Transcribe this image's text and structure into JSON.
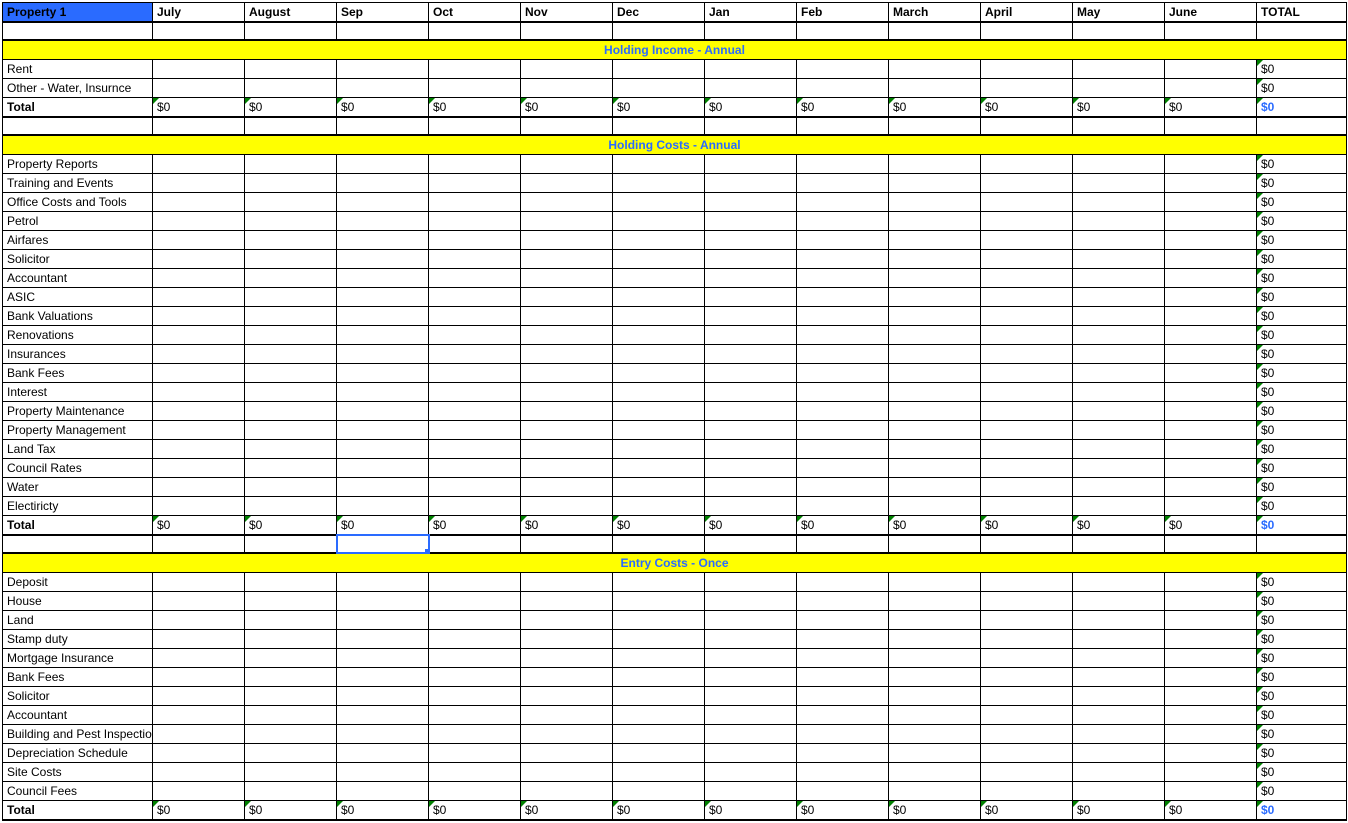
{
  "header": {
    "title": "Property 1",
    "months": [
      "July",
      "August",
      "Sep",
      "Oct",
      "Nov",
      "Dec",
      "Jan",
      "Feb",
      "March",
      "April",
      "May",
      "June"
    ],
    "total_label": "TOTAL"
  },
  "sections": [
    {
      "title": "Holding Income - Annual",
      "rows": [
        {
          "label": "Rent",
          "total": "$0"
        },
        {
          "label": "Other - Water, Insurnce",
          "total": "$0"
        }
      ],
      "total": {
        "label": "Total",
        "months": [
          "$0",
          "$0",
          "$0",
          "$0",
          "$0",
          "$0",
          "$0",
          "$0",
          "$0",
          "$0",
          "$0",
          "$0"
        ],
        "grand": "$0"
      }
    },
    {
      "title": "Holding Costs - Annual",
      "rows": [
        {
          "label": "Property Reports",
          "total": "$0"
        },
        {
          "label": "Training and Events",
          "total": "$0"
        },
        {
          "label": "Office Costs and Tools",
          "total": "$0"
        },
        {
          "label": "Petrol",
          "total": "$0"
        },
        {
          "label": "Airfares",
          "total": "$0"
        },
        {
          "label": "Solicitor",
          "total": "$0"
        },
        {
          "label": "Accountant",
          "total": "$0"
        },
        {
          "label": "ASIC",
          "total": "$0"
        },
        {
          "label": "Bank Valuations",
          "total": "$0"
        },
        {
          "label": "Renovations",
          "total": "$0"
        },
        {
          "label": "Insurances",
          "total": "$0"
        },
        {
          "label": "Bank Fees",
          "total": "$0"
        },
        {
          "label": "Interest",
          "total": "$0"
        },
        {
          "label": "Property Maintenance",
          "total": "$0"
        },
        {
          "label": "Property Management",
          "total": "$0"
        },
        {
          "label": "Land Tax",
          "total": "$0"
        },
        {
          "label": "Council Rates",
          "total": "$0"
        },
        {
          "label": "Water",
          "total": "$0"
        },
        {
          "label": "Electiricty",
          "total": "$0"
        }
      ],
      "total": {
        "label": "Total",
        "months": [
          "$0",
          "$0",
          "$0",
          "$0",
          "$0",
          "$0",
          "$0",
          "$0",
          "$0",
          "$0",
          "$0",
          "$0"
        ],
        "grand": "$0"
      }
    },
    {
      "title": "Entry Costs - Once",
      "rows": [
        {
          "label": "Deposit",
          "total": "$0"
        },
        {
          "label": "House",
          "total": "$0"
        },
        {
          "label": "Land",
          "total": "$0"
        },
        {
          "label": "Stamp duty",
          "total": "$0"
        },
        {
          "label": "Mortgage Insurance",
          "total": "$0"
        },
        {
          "label": "Bank Fees",
          "total": "$0"
        },
        {
          "label": "Solicitor",
          "total": "$0"
        },
        {
          "label": "Accountant",
          "total": "$0"
        },
        {
          "label": "Building and Pest Inspection",
          "total": "$0"
        },
        {
          "label": "Depreciation Schedule",
          "total": "$0"
        },
        {
          "label": "Site Costs",
          "total": "$0"
        },
        {
          "label": "Council Fees",
          "total": "$0"
        }
      ],
      "total": {
        "label": "Total",
        "months": [
          "$0",
          "$0",
          "$0",
          "$0",
          "$0",
          "$0",
          "$0",
          "$0",
          "$0",
          "$0",
          "$0",
          "$0"
        ],
        "grand": "$0"
      }
    }
  ],
  "selected_cell": {
    "section": 1,
    "type": "below_total",
    "month_index": 2
  }
}
